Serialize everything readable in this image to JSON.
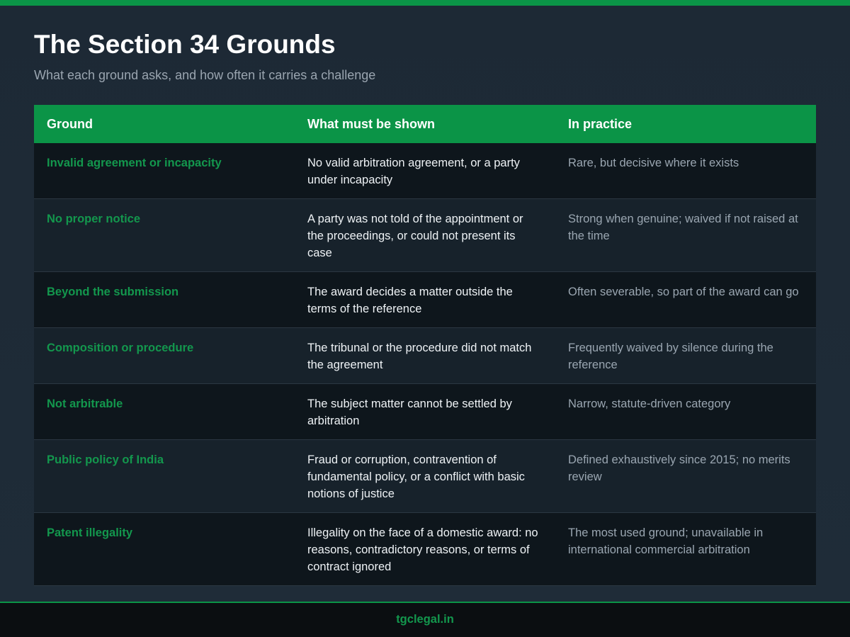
{
  "header": {
    "title": "The Section 34 Grounds",
    "subtitle": "What each ground asks, and how often it carries a challenge"
  },
  "table": {
    "columns": [
      "Ground",
      "What must be shown",
      "In practice"
    ],
    "rows": [
      {
        "ground": "Invalid agreement or incapacity",
        "shown": "No valid arbitration agreement, or a party under incapacity",
        "practice": "Rare, but decisive where it exists"
      },
      {
        "ground": "No proper notice",
        "shown": "A party was not told of the appointment or the proceedings, or could not present its case",
        "practice": "Strong when genuine; waived if not raised at the time"
      },
      {
        "ground": "Beyond the submission",
        "shown": "The award decides a matter outside the terms of the reference",
        "practice": "Often severable, so part of the award can go"
      },
      {
        "ground": "Composition or procedure",
        "shown": "The tribunal or the procedure did not match the agreement",
        "practice": "Frequently waived by silence during the reference"
      },
      {
        "ground": "Not arbitrable",
        "shown": "The subject matter cannot be settled by arbitration",
        "practice": "Narrow, statute-driven category"
      },
      {
        "ground": "Public policy of India",
        "shown": "Fraud or corruption, contravention of fundamental policy, or a conflict with basic notions of justice",
        "practice": "Defined exhaustively since 2015; no merits review"
      },
      {
        "ground": "Patent illegality",
        "shown": "Illegality on the face of a domestic award: no reasons, contradictory reasons, or terms of contract ignored",
        "practice": "The most used ground; unavailable in international commercial arbitration"
      }
    ]
  },
  "footer": {
    "site": "tgclegal.in"
  },
  "colors": {
    "accent": "#0b9447",
    "ground_text": "#13974d",
    "background": "#1d2935"
  }
}
